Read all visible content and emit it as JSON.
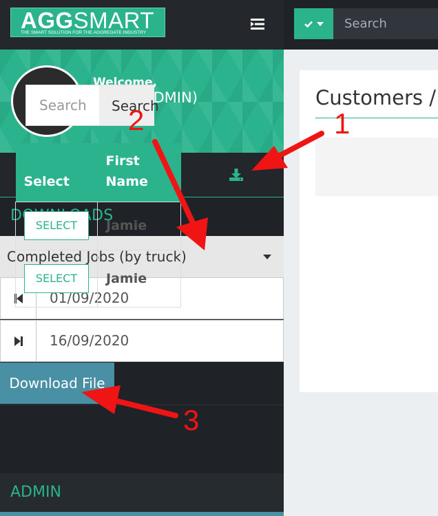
{
  "logo": {
    "main_bold": "AGG",
    "main_light": "SMART",
    "tagline": "THE SMART SOLUTION FOR THE AGGREGATE INDUSTRY"
  },
  "profile": {
    "welcome": "Welcome,",
    "name": "Jamie (ADMIN)"
  },
  "side_tabs": [
    {
      "icon": "list-icon",
      "active": false
    },
    {
      "icon": "envelope-icon",
      "active": false
    },
    {
      "icon": "download-icon",
      "active": true
    }
  ],
  "downloads": {
    "header": "DOWNLOADS",
    "report_selected": "Completed Jobs (by truck)",
    "start_date": "01/09/2020",
    "end_date": "16/09/2020",
    "download_label": "Download File"
  },
  "admin": {
    "header": "ADMIN"
  },
  "topbar": {
    "search_placeholder": "Search"
  },
  "main": {
    "title": "Customers / C",
    "search_placeholder": "Search",
    "search_button": "Search",
    "columns": [
      {
        "line1": "",
        "line2": "Select"
      },
      {
        "line1": "First",
        "line2": "Name"
      }
    ],
    "rows": [
      {
        "select_label": "SELECT",
        "first_name": "Jamie"
      },
      {
        "select_label": "SELECT",
        "first_name": "Jamie"
      }
    ]
  },
  "annotations": {
    "step1": "1",
    "step2": "2",
    "step3": "3"
  },
  "colors": {
    "accent": "#2ab38d",
    "sidebar_bg": "#1f2328",
    "download_button": "#4a90a4",
    "annotation_red": "#f01414"
  }
}
